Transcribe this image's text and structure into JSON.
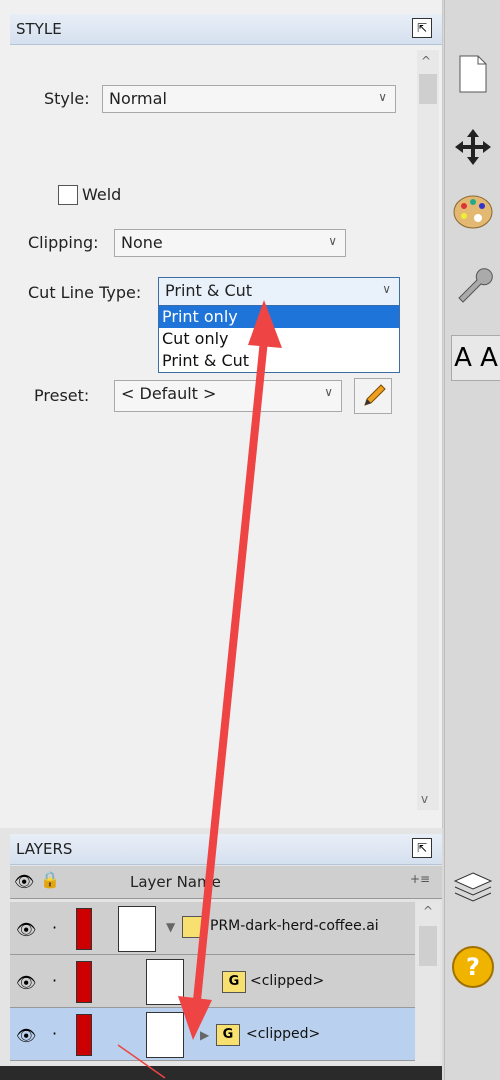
{
  "style_panel": {
    "header": "STYLE",
    "style_label": "Style:",
    "style_value": "Normal",
    "weld_label": "Weld",
    "clipping_label": "Clipping:",
    "clipping_value": "None",
    "cut_line_label": "Cut Line Type:",
    "cut_line_value": "Print & Cut",
    "cut_line_options": [
      "Print only",
      "Cut only",
      "Print & Cut"
    ],
    "cut_line_highlighted": "Print only",
    "preset_label": "Preset:",
    "preset_value": "< Default >"
  },
  "layers_panel": {
    "header": "LAYERS",
    "column_name": "Layer Name",
    "rows": [
      {
        "name": "PRM-dark-herd-coffee.ai"
      },
      {
        "name": "<clipped>"
      },
      {
        "name": "<clipped>"
      }
    ]
  },
  "right_toolbar": {
    "items": [
      "document-icon",
      "move-icon",
      "palette-icon",
      "wrench-icon",
      "text-size-icon",
      "layers-icon",
      "help-icon"
    ],
    "text_size_glyph": "A A",
    "help_glyph": "?"
  },
  "colors": {
    "arrow": "#ee4444",
    "selection": "#1e74d8",
    "layer_color_bar": "#cc0000"
  }
}
